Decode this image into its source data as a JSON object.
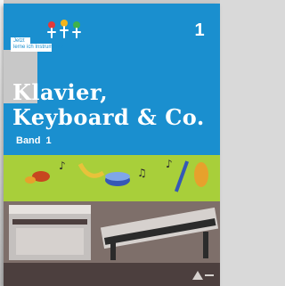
{
  "cover": {
    "series_line1": "Jetzt",
    "series_line2": "lerne ich Instrumente",
    "volume_number": "1",
    "title_line1": "Klavier,",
    "title_line2": "Keyboard & Co.",
    "band_label": "Band",
    "band_number": "1",
    "colors": {
      "background": "#1a8fcf",
      "band": "#a8cf3a",
      "floor": "#7e6f6a",
      "bottom": "#4c3f3e"
    },
    "icons": [
      "music-notes-icon",
      "violin-icon",
      "saxophone-icon",
      "drum-icon",
      "piano-icon",
      "keyboard-icon",
      "publisher-logo-icon"
    ]
  }
}
